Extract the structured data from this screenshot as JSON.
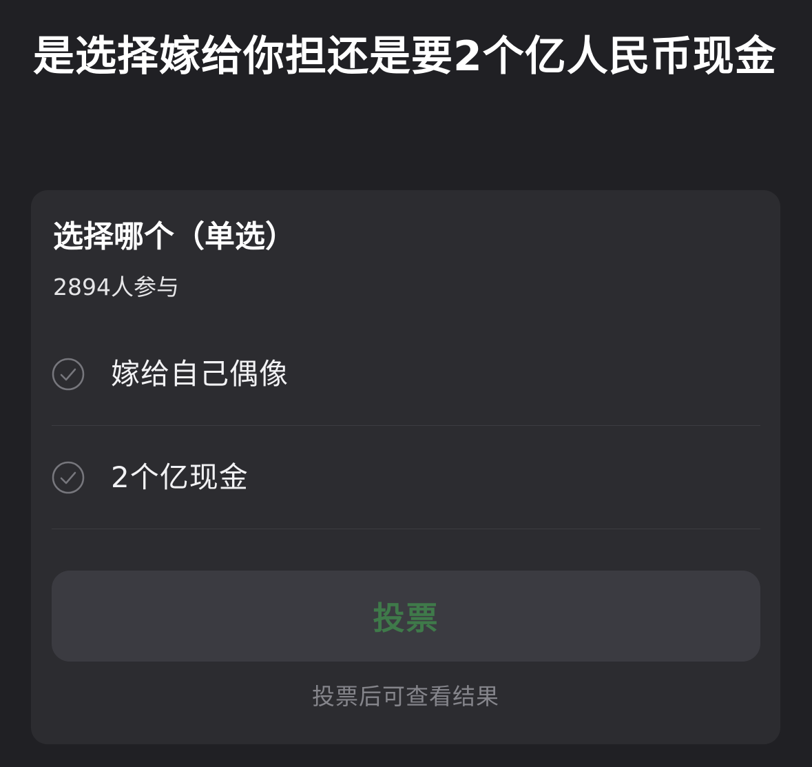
{
  "post": {
    "title": "是选择嫁给你担还是要2个亿人民币现金"
  },
  "poll": {
    "heading": "选择哪个（单选）",
    "participants": "2894人参与",
    "options": [
      {
        "label": "嫁给自己偶像",
        "icon": "check-circle-icon"
      },
      {
        "label": "2个亿现金",
        "icon": "check-circle-icon"
      }
    ],
    "vote_button_label": "投票",
    "result_hint": "投票后可查看结果"
  },
  "colors": {
    "background": "#202024",
    "card": "#2c2c30",
    "vote_text": "#3f7a4a",
    "hint_text": "#85858b"
  }
}
